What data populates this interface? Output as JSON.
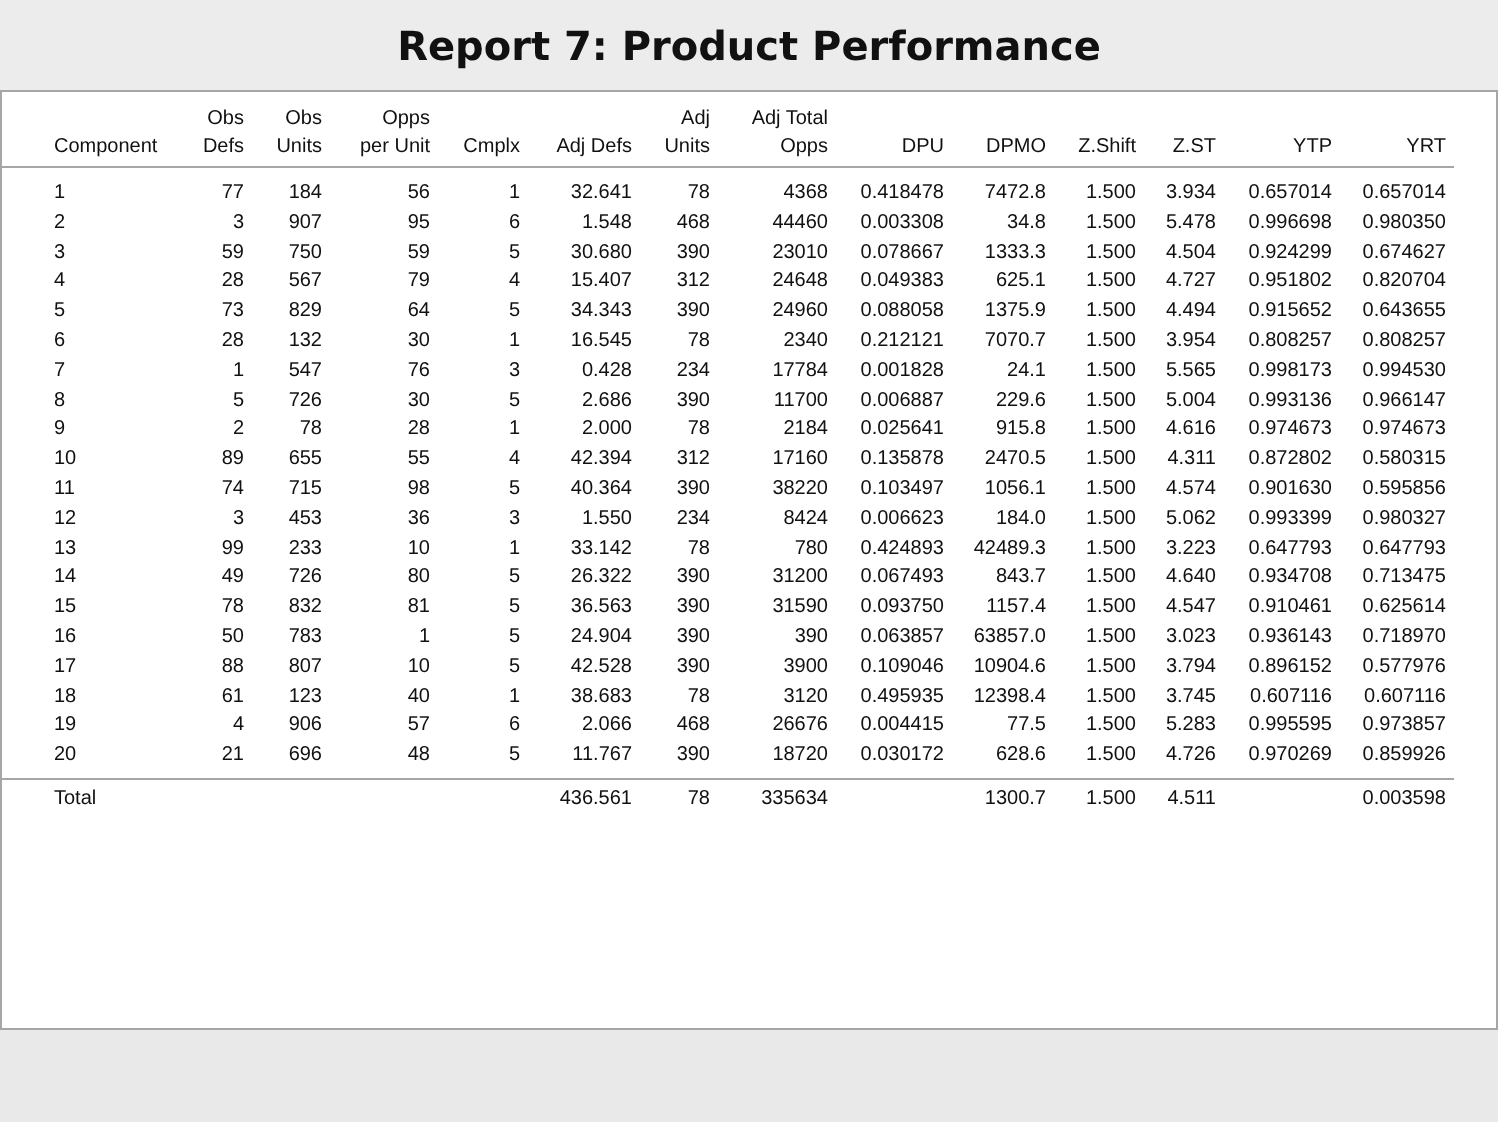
{
  "title": "Report 7: Product Performance",
  "columns": [
    {
      "lines": [
        "Component"
      ],
      "total": "Total"
    },
    {
      "lines": [
        "Obs",
        "Defs"
      ]
    },
    {
      "lines": [
        "Obs",
        "Units"
      ]
    },
    {
      "lines": [
        "Opps",
        "per Unit"
      ]
    },
    {
      "lines": [
        "Cmplx"
      ]
    },
    {
      "lines": [
        "Adj Defs"
      ],
      "total": "436.561"
    },
    {
      "lines": [
        "Adj",
        "Units"
      ],
      "total": "78"
    },
    {
      "lines": [
        "Adj Total",
        "Opps"
      ],
      "total": "335634"
    },
    {
      "lines": [
        "DPU"
      ]
    },
    {
      "lines": [
        "DPMO"
      ],
      "total": "1300.7"
    },
    {
      "lines": [
        "Z.Shift"
      ],
      "total": "1.500"
    },
    {
      "lines": [
        "Z.ST"
      ],
      "total": "4.511"
    },
    {
      "lines": [
        "YTP"
      ]
    },
    {
      "lines": [
        "YRT"
      ],
      "total": "0.003598"
    }
  ],
  "rows": [
    [
      "1",
      "77",
      "184",
      "56",
      "1",
      "32.641",
      "78",
      "4368",
      "0.418478",
      "7472.8",
      "1.500",
      "3.934",
      "0.657014",
      "0.657014"
    ],
    [
      "2",
      "3",
      "907",
      "95",
      "6",
      "1.548",
      "468",
      "44460",
      "0.003308",
      "34.8",
      "1.500",
      "5.478",
      "0.996698",
      "0.980350"
    ],
    [
      "3",
      "59",
      "750",
      "59",
      "5",
      "30.680",
      "390",
      "23010",
      "0.078667",
      "1333.3",
      "1.500",
      "4.504",
      "0.924299",
      "0.674627"
    ],
    [
      "4",
      "28",
      "567",
      "79",
      "4",
      "15.407",
      "312",
      "24648",
      "0.049383",
      "625.1",
      "1.500",
      "4.727",
      "0.951802",
      "0.820704"
    ],
    [
      "5",
      "73",
      "829",
      "64",
      "5",
      "34.343",
      "390",
      "24960",
      "0.088058",
      "1375.9",
      "1.500",
      "4.494",
      "0.915652",
      "0.643655"
    ],
    [
      "6",
      "28",
      "132",
      "30",
      "1",
      "16.545",
      "78",
      "2340",
      "0.212121",
      "7070.7",
      "1.500",
      "3.954",
      "0.808257",
      "0.808257"
    ],
    [
      "7",
      "1",
      "547",
      "76",
      "3",
      "0.428",
      "234",
      "17784",
      "0.001828",
      "24.1",
      "1.500",
      "5.565",
      "0.998173",
      "0.994530"
    ],
    [
      "8",
      "5",
      "726",
      "30",
      "5",
      "2.686",
      "390",
      "11700",
      "0.006887",
      "229.6",
      "1.500",
      "5.004",
      "0.993136",
      "0.966147"
    ],
    [
      "9",
      "2",
      "78",
      "28",
      "1",
      "2.000",
      "78",
      "2184",
      "0.025641",
      "915.8",
      "1.500",
      "4.616",
      "0.974673",
      "0.974673"
    ],
    [
      "10",
      "89",
      "655",
      "55",
      "4",
      "42.394",
      "312",
      "17160",
      "0.135878",
      "2470.5",
      "1.500",
      "4.311",
      "0.872802",
      "0.580315"
    ],
    [
      "11",
      "74",
      "715",
      "98",
      "5",
      "40.364",
      "390",
      "38220",
      "0.103497",
      "1056.1",
      "1.500",
      "4.574",
      "0.901630",
      "0.595856"
    ],
    [
      "12",
      "3",
      "453",
      "36",
      "3",
      "1.550",
      "234",
      "8424",
      "0.006623",
      "184.0",
      "1.500",
      "5.062",
      "0.993399",
      "0.980327"
    ],
    [
      "13",
      "99",
      "233",
      "10",
      "1",
      "33.142",
      "78",
      "780",
      "0.424893",
      "42489.3",
      "1.500",
      "3.223",
      "0.647793",
      "0.647793"
    ],
    [
      "14",
      "49",
      "726",
      "80",
      "5",
      "26.322",
      "390",
      "31200",
      "0.067493",
      "843.7",
      "1.500",
      "4.640",
      "0.934708",
      "0.713475"
    ],
    [
      "15",
      "78",
      "832",
      "81",
      "5",
      "36.563",
      "390",
      "31590",
      "0.093750",
      "1157.4",
      "1.500",
      "4.547",
      "0.910461",
      "0.625614"
    ],
    [
      "16",
      "50",
      "783",
      "1",
      "5",
      "24.904",
      "390",
      "390",
      "0.063857",
      "63857.0",
      "1.500",
      "3.023",
      "0.936143",
      "0.718970"
    ],
    [
      "17",
      "88",
      "807",
      "10",
      "5",
      "42.528",
      "390",
      "3900",
      "0.109046",
      "10904.6",
      "1.500",
      "3.794",
      "0.896152",
      "0.577976"
    ],
    [
      "18",
      "61",
      "123",
      "40",
      "1",
      "38.683",
      "78",
      "3120",
      "0.495935",
      "12398.4",
      "1.500",
      "3.745",
      "0.607116",
      "0.607116"
    ],
    [
      "19",
      "4",
      "906",
      "57",
      "6",
      "2.066",
      "468",
      "26676",
      "0.004415",
      "77.5",
      "1.500",
      "5.283",
      "0.995595",
      "0.973857"
    ],
    [
      "20",
      "21",
      "696",
      "48",
      "5",
      "11.767",
      "390",
      "18720",
      "0.030172",
      "628.6",
      "1.500",
      "4.726",
      "0.970269",
      "0.859926"
    ]
  ]
}
